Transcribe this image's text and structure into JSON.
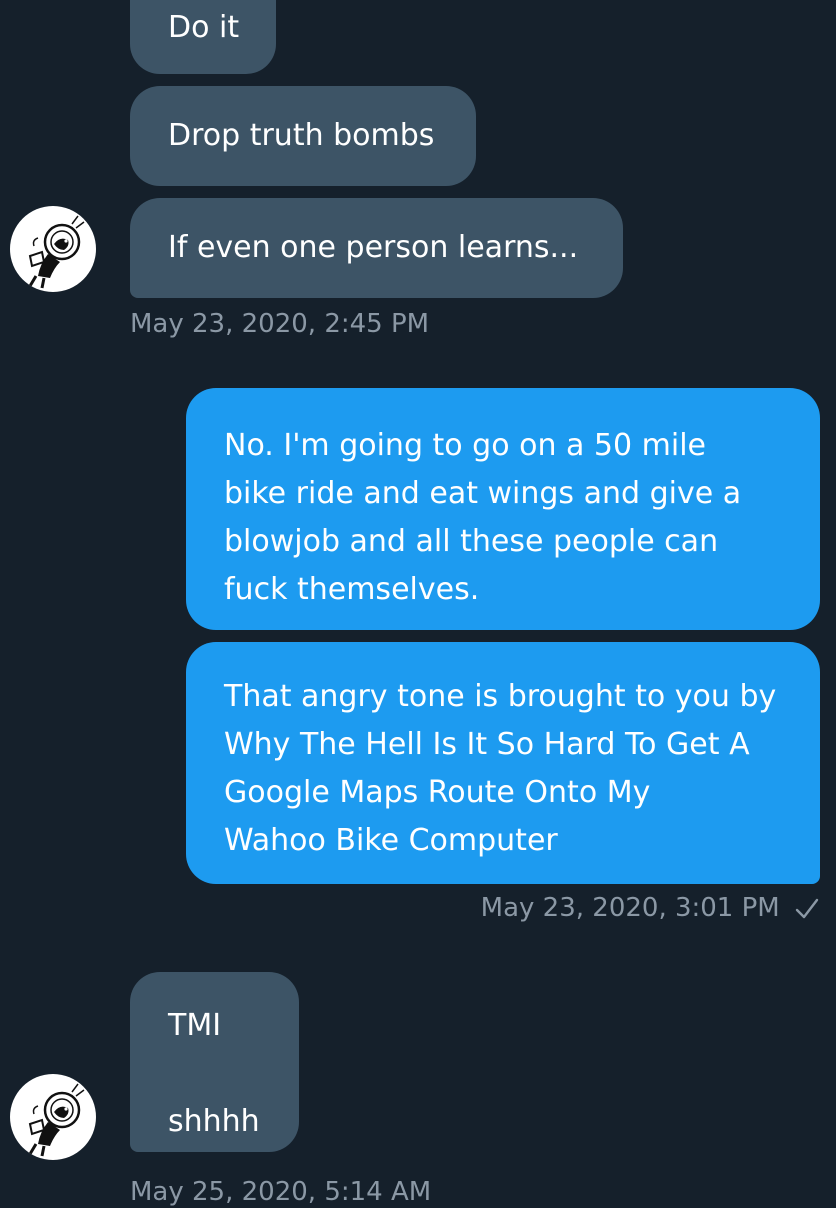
{
  "conversation": {
    "messages": [
      {
        "id": "m1",
        "direction": "received",
        "text": "Do it"
      },
      {
        "id": "m2",
        "direction": "received",
        "text": "Drop truth bombs"
      },
      {
        "id": "m3",
        "direction": "received",
        "text": "If even one person learns..."
      },
      {
        "id": "m4",
        "direction": "sent",
        "text": "No.  I'm going to go on a 50 mile\nbike ride and eat wings and give a\nblowjob and all these people can\nfuck themselves."
      },
      {
        "id": "m5",
        "direction": "sent",
        "text": "That angry tone is brought to you by\nWhy The Hell Is It So Hard To Get A\nGoogle Maps Route Onto My\nWahoo Bike Computer"
      },
      {
        "id": "m6",
        "direction": "received",
        "text": "TMI\n\nshhhh"
      }
    ],
    "timestamps": {
      "group1": "May 23, 2020, 2:45 PM",
      "group2": "May 23, 2020, 3:01 PM",
      "group3": "May 25, 2020, 5:14 AM"
    },
    "read_receipt_icon": "checkmark-icon",
    "avatar_icon": "dog-astronaut-avatar-icon"
  },
  "colors": {
    "background": "#15202b",
    "received_bubble": "#3d5466",
    "sent_bubble": "#1d9bf0",
    "timestamp_text": "#8b98a5"
  }
}
